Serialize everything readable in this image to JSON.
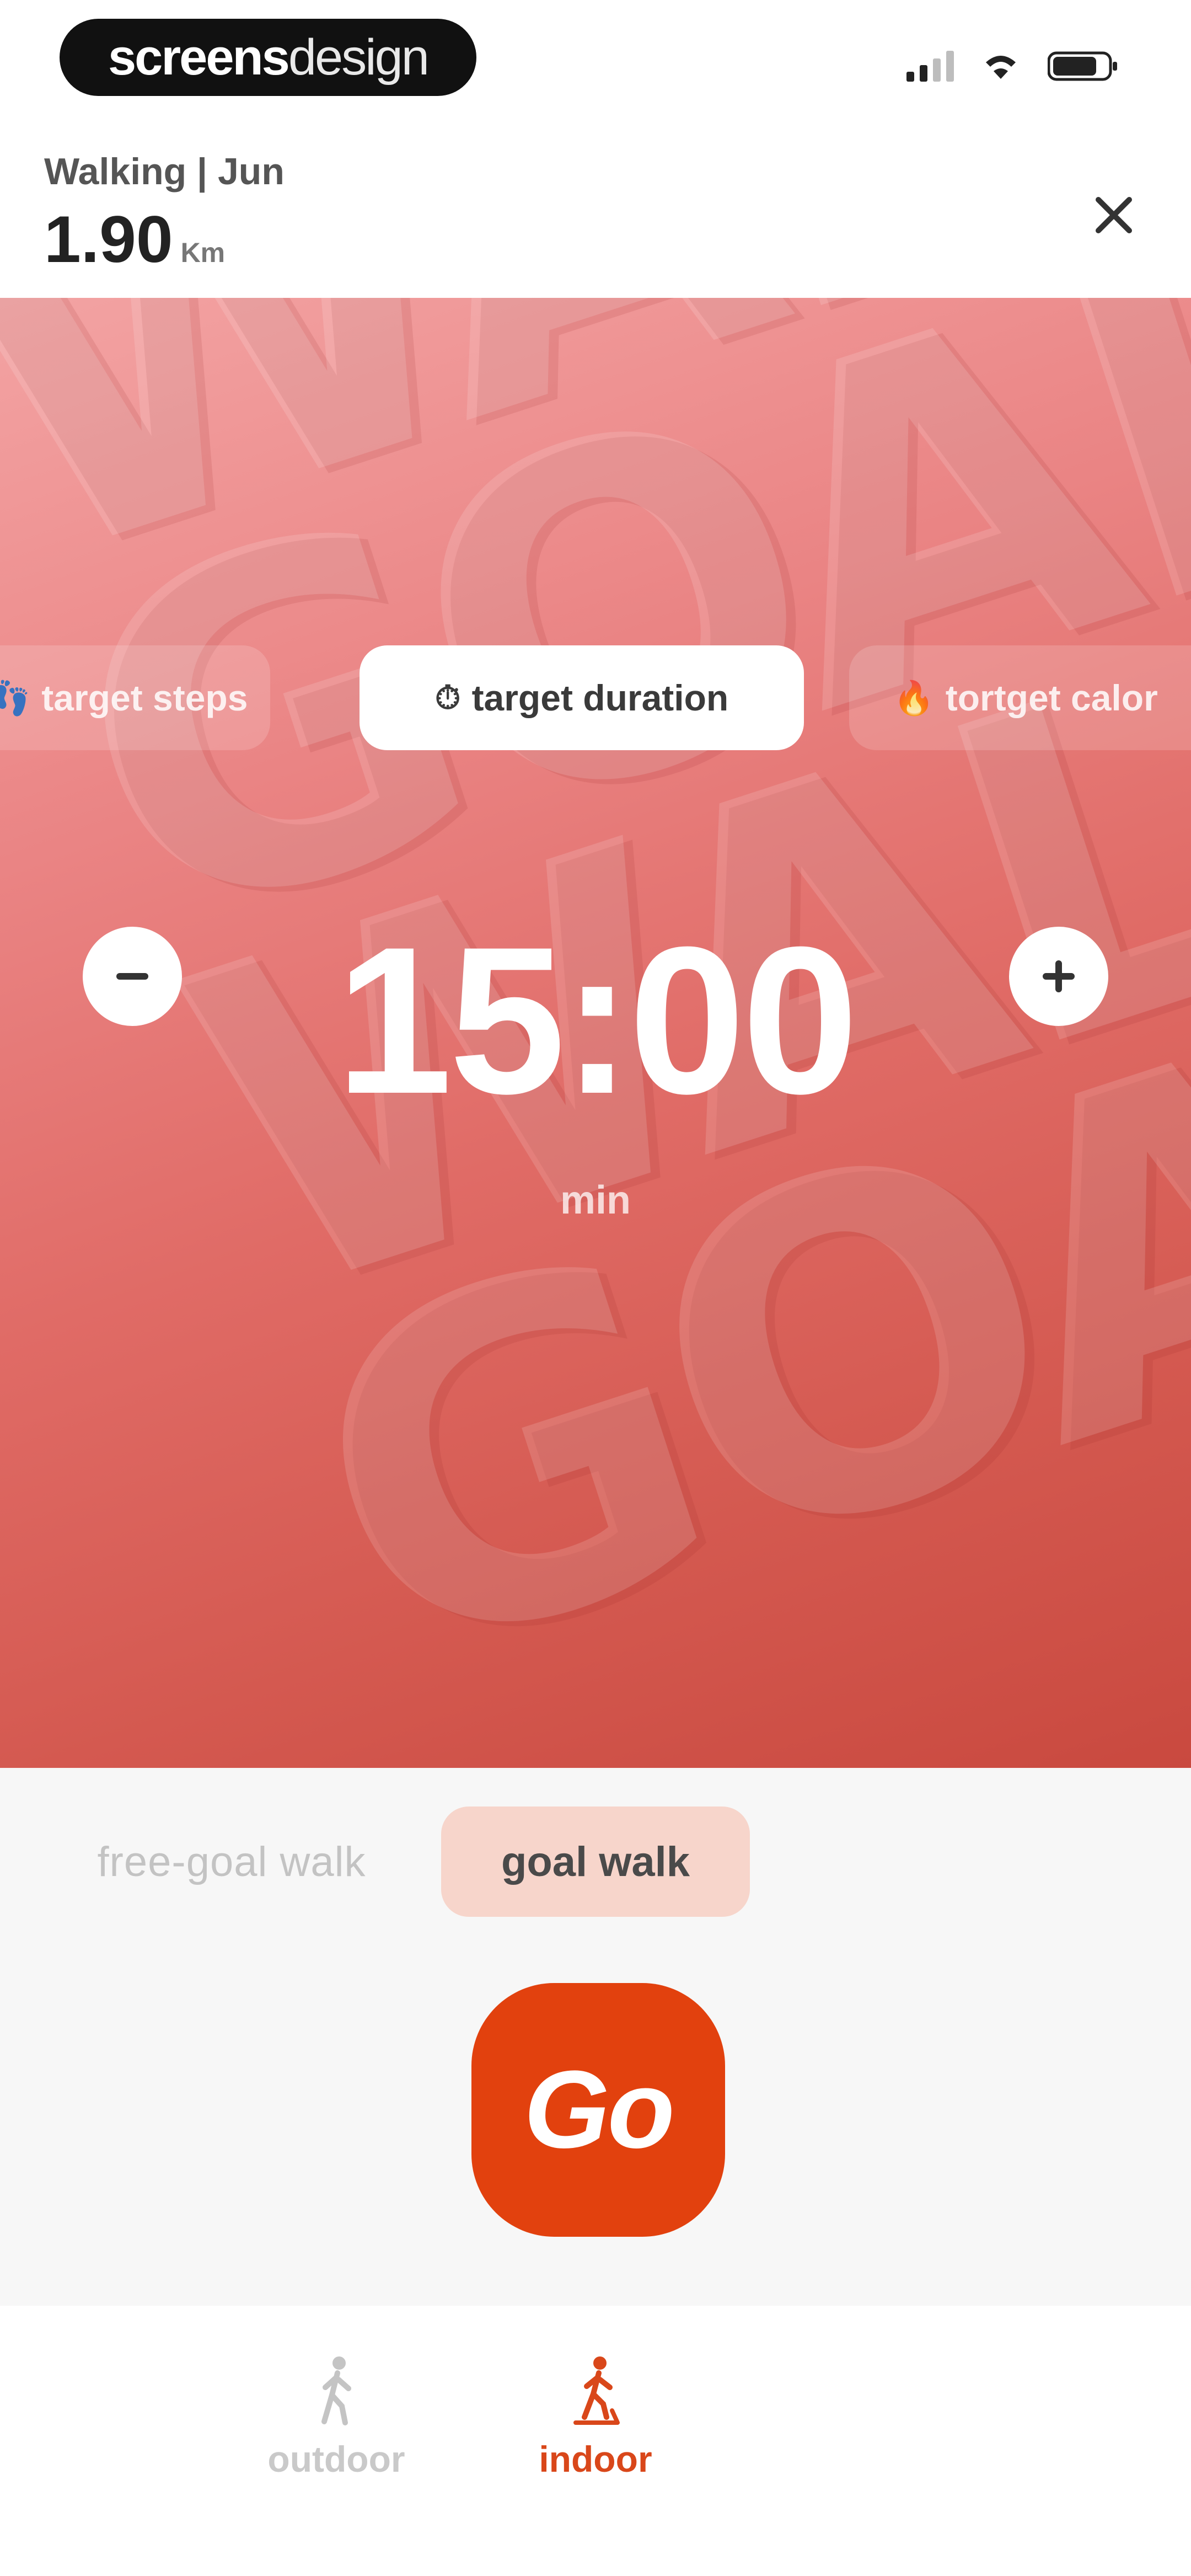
{
  "status_bar": {
    "brand_bold": "screens",
    "brand_light": "design"
  },
  "header": {
    "subtitle": "Walking | Jun",
    "distance_value": "1.90",
    "distance_unit": "Km"
  },
  "goal_types": [
    {
      "label": "target steps",
      "icon": "footprints-icon",
      "active": false
    },
    {
      "label": "target duration",
      "icon": "stopwatch-icon",
      "active": true
    },
    {
      "label": "tortget calor",
      "icon": "flame-icon",
      "active": false
    }
  ],
  "timer": {
    "value": "15:00",
    "unit": "min"
  },
  "modes": {
    "free_goal": "free-goal walk",
    "goal": "goal walk",
    "selected": "goal walk"
  },
  "go_label": "Go",
  "bottom_nav": {
    "outdoor": "outdoor",
    "indoor": "indoor",
    "selected": "indoor"
  },
  "background_words": [
    "WALK",
    "GOAL",
    "WALK",
    "GOAL"
  ],
  "colors": {
    "accent": "#e2410e",
    "hero_top": "#f3a3a3",
    "hero_bottom": "#c9493f",
    "active_nav": "#d9471a"
  }
}
